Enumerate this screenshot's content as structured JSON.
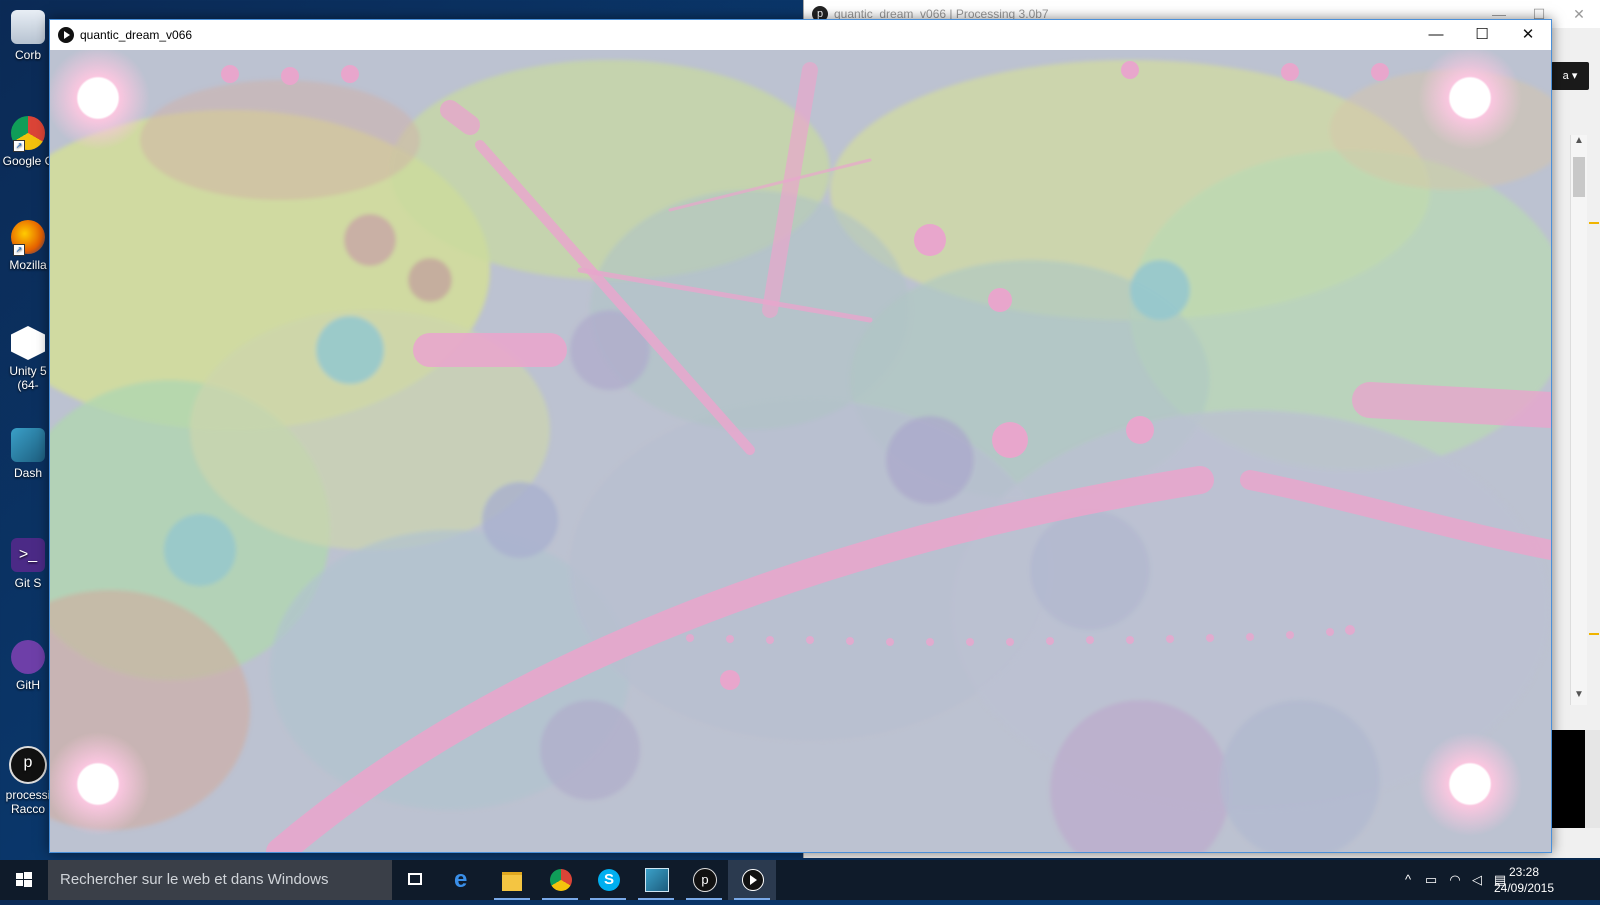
{
  "desktop": {
    "icons": [
      {
        "label": "Corb",
        "icon": "recycle-bin-icon"
      },
      {
        "label": "Google C",
        "icon": "chrome-icon"
      },
      {
        "label": "Mozilla",
        "icon": "firefox-icon"
      },
      {
        "label": "Unity 5",
        "label2": "(64-",
        "icon": "unity-icon"
      },
      {
        "label": "Dash",
        "icon": "dash-icon"
      },
      {
        "label": "Git S",
        "icon": "git-shell-icon"
      },
      {
        "label": "GitH",
        "icon": "github-icon"
      },
      {
        "label": "processi",
        "label2": "Racco",
        "icon": "processing-icon"
      }
    ]
  },
  "background_window": {
    "title": "quantic_dream_v066 | Processing 3.0b7",
    "minimize": "—",
    "maximize": "☐",
    "close": "✕",
    "dropdown": "a ▾"
  },
  "window": {
    "title": "quantic_dream_v066",
    "minimize_glyph": "—",
    "maximize_glyph": "☐",
    "close_glyph": "✕"
  },
  "taskbar": {
    "search_placeholder": "Rechercher sur le web et dans Windows",
    "apps": [
      "task-view-icon",
      "edge-icon",
      "file-explorer-icon",
      "chrome-icon",
      "skype-icon",
      "dash-icon",
      "processing-icon",
      "sketch-window-icon"
    ],
    "time": "23:28",
    "date": "24/09/2015"
  },
  "colors": {
    "accent_pink": "#f39ac9",
    "canvas_base": "#b9bfcf",
    "taskbar": "#0f1b2a"
  }
}
